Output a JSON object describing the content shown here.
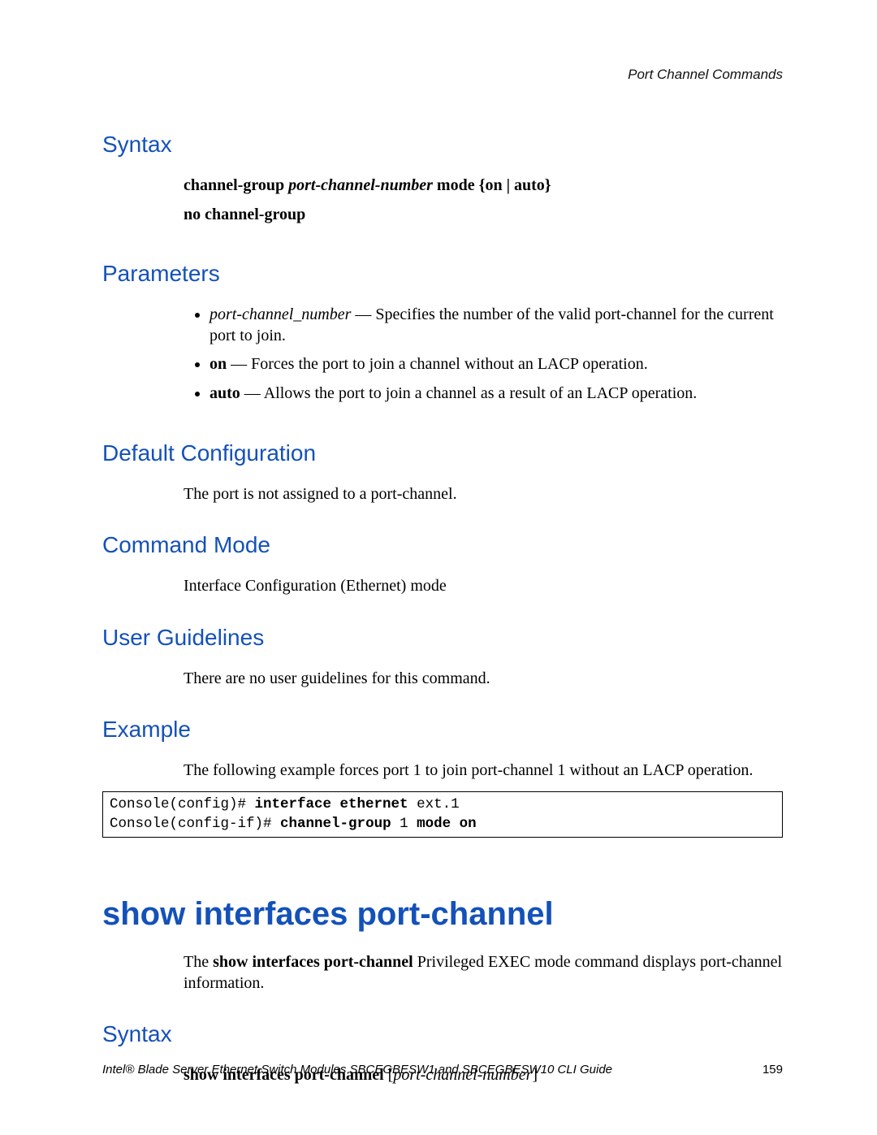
{
  "running_header": "Port Channel Commands",
  "sections": {
    "syntax1": {
      "heading": "Syntax",
      "line1": {
        "t1": "channel-group ",
        "t2": "port-channel-number",
        "t3": " mode {on | auto}"
      },
      "line2": "no channel-group"
    },
    "parameters": {
      "heading": "Parameters",
      "items": {
        "p1": {
          "term": "port-channel_number",
          "dash": " — ",
          "desc": "Specifies the number of the valid port-channel for the current port to join."
        },
        "p2": {
          "term": "on",
          "dash": " — ",
          "desc": "Forces the port to join a channel without an LACP operation."
        },
        "p3": {
          "term": "auto",
          "dash": " — ",
          "desc": "Allows the port to join a channel as a result of an LACP operation."
        }
      }
    },
    "defaultcfg": {
      "heading": "Default Configuration",
      "text": "The port is not assigned to a port-channel."
    },
    "cmdmode": {
      "heading": "Command Mode",
      "text": "Interface Configuration (Ethernet) mode"
    },
    "userguidelines": {
      "heading": "User Guidelines",
      "text": "There are no user guidelines for this command."
    },
    "example": {
      "heading": "Example",
      "intro": "The following example forces port 1 to join port-channel 1 without an LACP operation.",
      "code": {
        "l1a": "Console(config)# ",
        "l1b": "interface ethernet",
        "l1c": " ext.1",
        "l2a": "Console(config-if)# ",
        "l2b": "channel-group",
        "l2c": " 1 ",
        "l2d": "mode on"
      }
    },
    "show_cmd": {
      "heading": "show interfaces port-channel",
      "desc1": "The ",
      "desc_bold": "show interfaces port-channel",
      "desc2": " Privileged EXEC mode command displays port-channel information.",
      "syntax_heading": "Syntax",
      "syntax": {
        "t1": "show interfaces port-channel",
        "t2": " [",
        "t3": "port-channel-number",
        "t4": "]"
      }
    }
  },
  "footer": {
    "title": "Intel® Blade Server Ethernet Switch Modules SBCEGBESW1 and SBCEGBESW10 CLI Guide",
    "page": "159"
  }
}
